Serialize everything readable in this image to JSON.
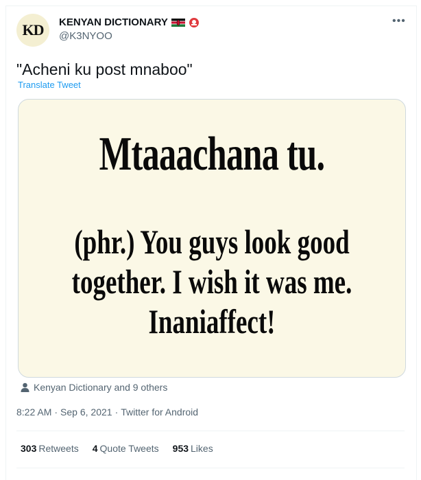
{
  "account": {
    "avatar_text": "KD",
    "display_name": "KENYAN DICTIONARY",
    "handle": "@K3NYOO",
    "badge_icons": [
      "kenya-flag-icon",
      "emoji-badge-icon"
    ]
  },
  "tweet": {
    "text": "\"Acheni ku post mnaboo\"",
    "translate_label": "Translate Tweet",
    "media": {
      "headword": "Mtaaachana tu.",
      "definition": "(phr.) You guys look good\ntogether. I wish it was me.\nInaniaffect!"
    }
  },
  "liked_by": "Kenyan Dictionary and 9 others",
  "meta": {
    "time": "8:22 AM",
    "separator1": "·",
    "date": "Sep 6, 2021",
    "separator2": "·",
    "source": "Twitter for Android"
  },
  "stats": {
    "retweets_count": "303",
    "retweets_label": "Retweets",
    "quotes_count": "4",
    "quotes_label": "Quote Tweets",
    "likes_count": "953",
    "likes_label": "Likes"
  },
  "more_icon": "more-horizontal-icon",
  "colors": {
    "link": "#1d9bf0",
    "secondary_text": "#536471",
    "media_background": "#fbf8e6"
  }
}
